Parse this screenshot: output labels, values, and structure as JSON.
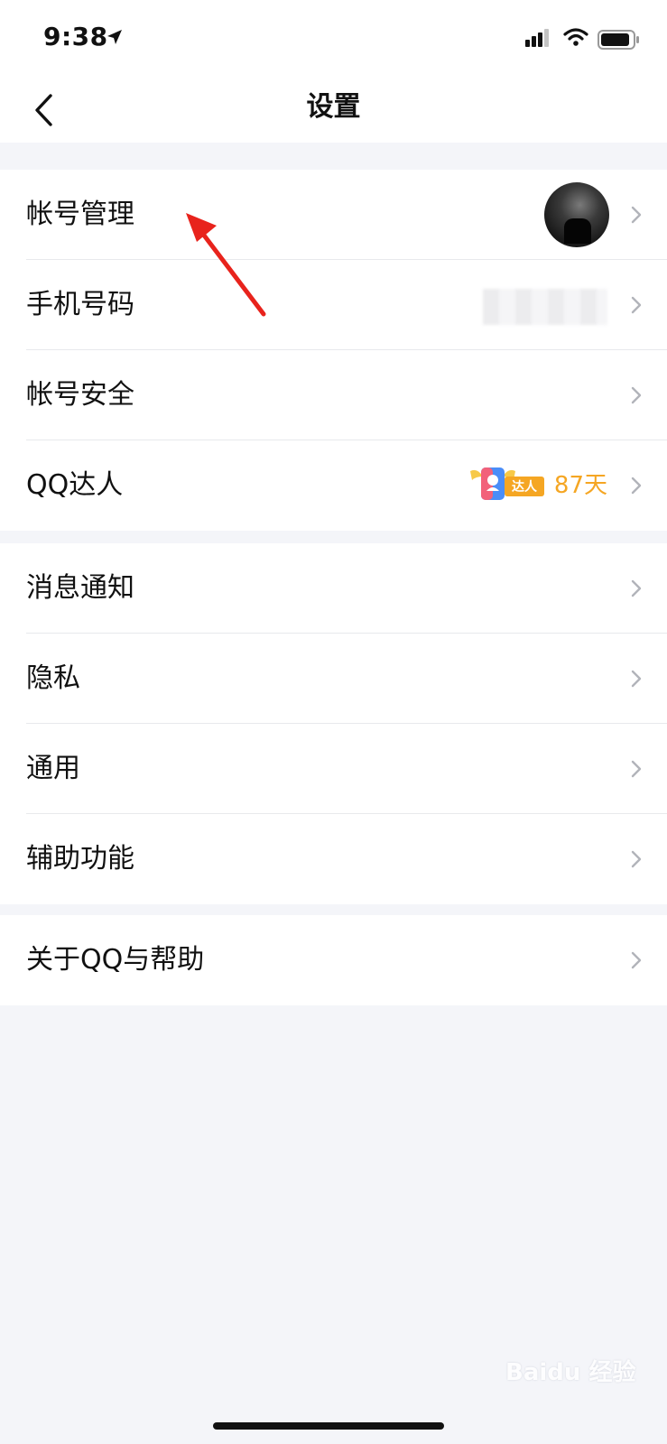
{
  "status_bar": {
    "time": "9:38"
  },
  "nav": {
    "title": "设置"
  },
  "groups": [
    {
      "items": [
        {
          "label": "帐号管理"
        },
        {
          "label": "手机号码"
        },
        {
          "label": "帐号安全"
        },
        {
          "label": "QQ达人",
          "badge_text": "达人",
          "days": "87天"
        }
      ]
    },
    {
      "items": [
        {
          "label": "消息通知"
        },
        {
          "label": "隐私"
        },
        {
          "label": "通用"
        },
        {
          "label": "辅助功能"
        }
      ]
    },
    {
      "items": [
        {
          "label": "关于QQ与帮助"
        }
      ]
    }
  ],
  "watermark": "Baidu 经验",
  "colors": {
    "background": "#f4f5f9",
    "accent_orange": "#f5a623",
    "annotation_red": "#e8231c"
  }
}
